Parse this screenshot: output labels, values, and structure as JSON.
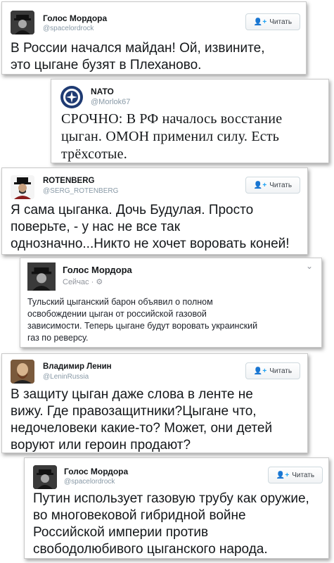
{
  "colors": {
    "accent": "#1da1f2",
    "handle": "#8899a6",
    "text": "#14171a"
  },
  "tweets": [
    {
      "name": "Голос Мордора",
      "handle": "@spacelordrock",
      "follow_label": "Читать",
      "avatar": "man-in-hat-photo",
      "lines": [
        "В России начался майдан! Ой, извините,",
        "это цыгане бузят в Плеханово."
      ]
    },
    {
      "name": "NATO",
      "handle": "@Morlok67",
      "avatar": "nato-seal-logo",
      "lines": [
        "СРОЧНО: В РФ началось восстание",
        "цыган. ОМОН применил силу. Есть",
        "трёхсотые."
      ]
    },
    {
      "name": "ROTENBERG",
      "handle": "@SERG_ROTENBERG",
      "follow_label": "Читать",
      "avatar": "man-in-hat-photo",
      "lines": [
        "Я сама цыганка. Дочь Будулая. Просто",
        "поверьте, - у нас не все так",
        "однозначно...Никто не хочет воровать коней!"
      ]
    },
    {
      "name": "Голос Мордора",
      "meta": "Сейчас ·",
      "avatar": "man-in-hat-photo",
      "lines": [
        "Тульский цыганский барон объявил о полном",
        "освобождении цыган от российской газовой",
        "зависимости. Теперь цыгане будут воровать украинский",
        "газ по реверсу."
      ]
    },
    {
      "name": "Владимир Ленин",
      "handle": "@LeninRussia",
      "follow_label": "Читать",
      "avatar": "lenin-portrait",
      "lines": [
        "В защиту цыган даже слова в ленте не",
        "вижу. Где правозащитники?Цыгане что,",
        "недочеловеки какие-то? Может, они детей",
        "воруют или героин продают?"
      ]
    },
    {
      "name": "Голос Мордора",
      "handle": "@spacelordrock",
      "follow_label": "Читать",
      "avatar": "man-in-hat-photo",
      "lines": [
        "Путин использует газовую трубу как оружие,",
        "во многовековой гибридной войне",
        "Российской империи против",
        "свободолюбивого цыганского народа."
      ]
    }
  ]
}
